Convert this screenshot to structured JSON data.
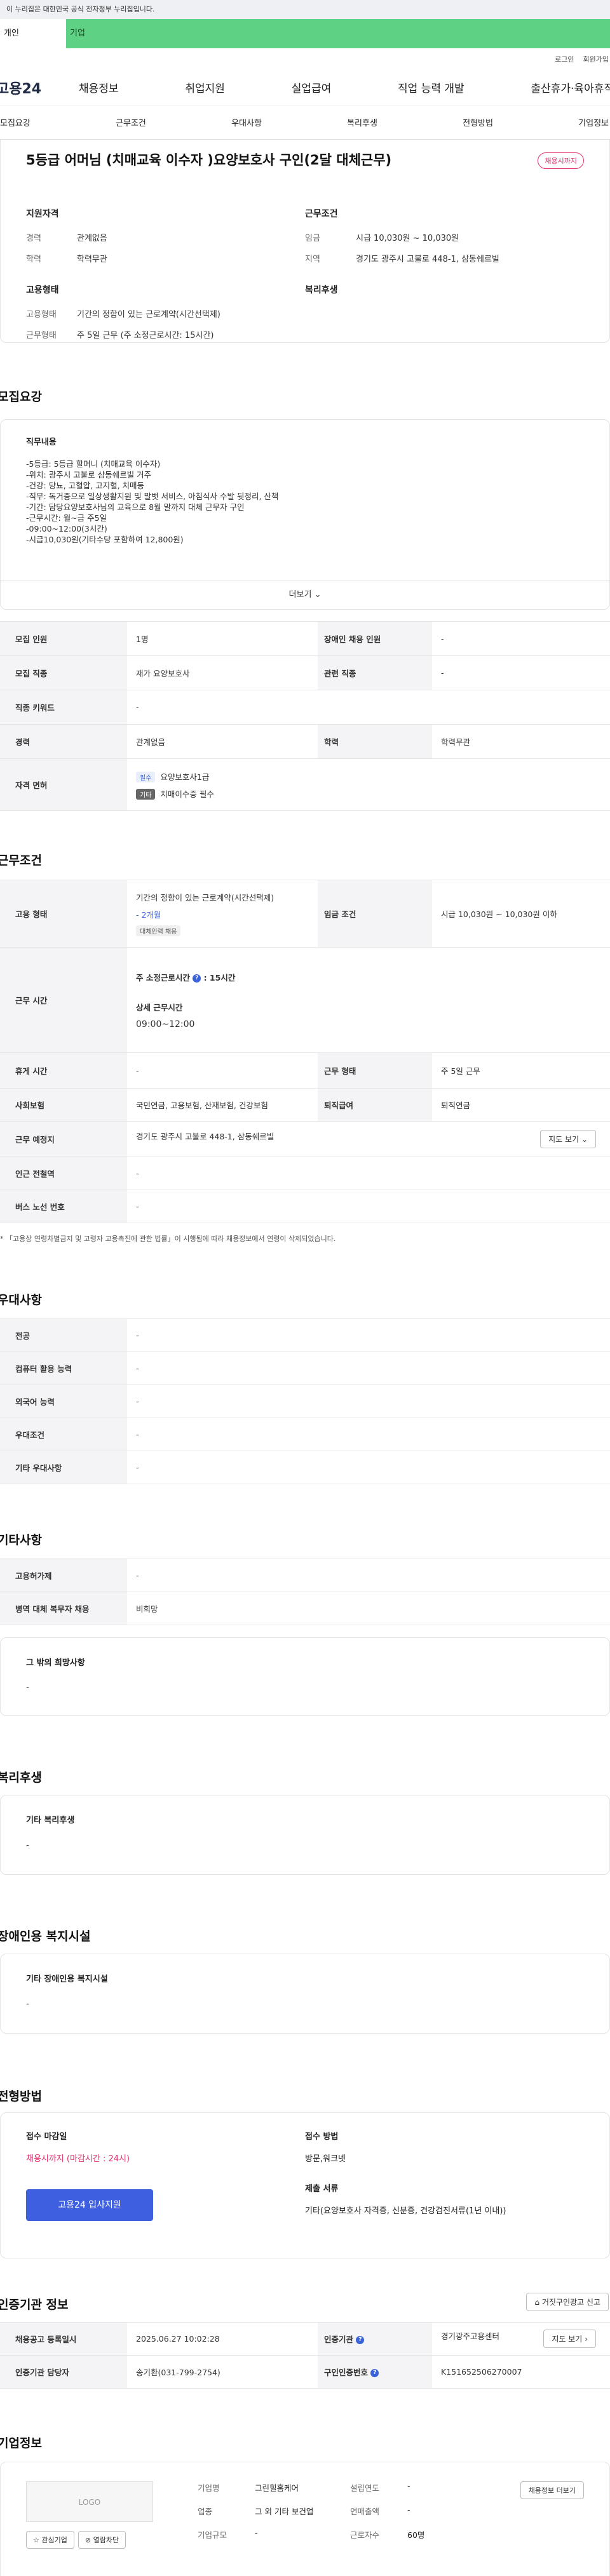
{
  "gov_banner": "이 누리집은 대한민국 공식 전자정부 누리집입니다.",
  "user_types": {
    "personal": "개인",
    "company": "기업"
  },
  "util": {
    "login": "로그인",
    "signup": "회원가입"
  },
  "logo": "고용24",
  "gnb": [
    "채용정보",
    "취업지원",
    "실업급여",
    "직업 능력 개발",
    "출산휴가·육아휴직"
  ],
  "subnav": [
    "모집요강",
    "근무조건",
    "우대사항",
    "복리후생",
    "전형방법",
    "기업정보"
  ],
  "job": {
    "title": "5등급 어머님 (치매교육 이수자 )요양보호사 구인(2달 대체근무)",
    "status_badge": "채용시까지",
    "summary": {
      "qual_heading": "지원자격",
      "career_label": "경력",
      "career": "관계없음",
      "edu_label": "학력",
      "edu": "학력무관",
      "cond_heading": "근무조건",
      "wage_label": "임금",
      "wage": "시급 10,030원 ~ 10,030원",
      "region_label": "지역",
      "region": "경기도 광주시 고불로 448-1, 삼동쉐르빌",
      "emp_heading": "고용형태",
      "emp_type_label": "고용형태",
      "emp_type": "기간의 정함이 있는 근로계약(시간선택제)",
      "work_type_label": "근무형태",
      "work_type": "주 5일 근무 (주 소정근로시간: 15시간)",
      "welfare_heading": "복리후생"
    }
  },
  "recruit": {
    "heading": "모집요강",
    "duty_heading": "직무내용",
    "duty_lines": [
      "-5등급: 5등급 할머니 (치매교육 이수자)",
      "-위치: 광주시 고불로 삼동쉐르빌 거주",
      "-건강: 당뇨, 고혈압, 고지혈, 치매등",
      "-직무: 독거중으로 일상생활지원 및 말벗 서비스, 아침식사 수발 뒷정리, 산책",
      "-기간: 담당요양보호사님의 교육으로 8월 말까지 대체 근무자 구인",
      "-근무시간: 월~금 주5일",
      "-09:00~12:00(3시간)",
      "-시급10,030원(기타수당 포함하여 12,800원)"
    ],
    "more": "더보기",
    "rows": {
      "count_k": "모집 인원",
      "count_v": "1명",
      "disabled_k": "장애인 채용 인원",
      "disabled_v": "-",
      "job_k": "모집 직종",
      "job_v": "재가 요양보호사",
      "related_k": "관련 직종",
      "related_v": "-",
      "keyword_k": "직종 키워드",
      "keyword_v": "-",
      "career_k": "경력",
      "career_v": "관계없음",
      "edu_k": "학력",
      "edu_v": "학력무관",
      "license_k": "자격 면허",
      "license_tag1": "필수",
      "license_v1": "요양보호사1급",
      "license_tag2": "기타",
      "license_v2": "치매이수증 필수"
    }
  },
  "conditions": {
    "heading": "근무조건",
    "emp_k": "고용 형태",
    "emp_v": "기간의 정함이 있는 근로계약(시간선택제)",
    "emp_period": "- 2개월",
    "emp_tag": "대체인력 채용",
    "wage_k": "임금 조건",
    "wage_v": "시급 10,030원 ~ 10,030원 이하",
    "time_k": "근무 시간",
    "time_weekly_label": "주 소정근로시간",
    "time_weekly": ": 15시간",
    "time_detail_label": "상세 근무시간",
    "time_detail": "09:00~12:00",
    "holiday_k": "휴게 시간",
    "holiday_v": "-",
    "worktype_k": "근무 형태",
    "worktype_v": "주 5일 근무",
    "insurance_k": "사회보험",
    "insurance_v": "국민연금, 고용보험, 산재보험, 건강보험",
    "retire_k": "퇴직급여",
    "retire_v": "퇴직연금",
    "place_k": "근무 예정지",
    "place_v": "경기도 광주시 고불로 448-1, 삼동쉐르빌",
    "map_btn": "지도 보기",
    "subway_k": "인근 전철역",
    "subway_v": "-",
    "bus_k": "버스 노선 번호",
    "bus_v": "-",
    "note": "* 「고용상 연령차별금지 및 고령자 고용촉진에 관한 법률」이 시행됨에 따라 채용정보에서 연령이 삭제되었습니다."
  },
  "preference": {
    "heading": "우대사항",
    "major_k": "전공",
    "major_v": "-",
    "computer_k": "컴퓨터 활용 능력",
    "computer_v": "-",
    "lang_k": "외국어 능력",
    "lang_v": "-",
    "cond_k": "우대조건",
    "cond_v": "-",
    "etc_k": "기타 우대사항",
    "etc_v": "-"
  },
  "other": {
    "heading": "기타사항",
    "hire_k": "고용허가제",
    "hire_v": "-",
    "military_k": "병역 대체 복무자 채용",
    "military_v": "비희망",
    "wish_h": "그 밖의 희망사항",
    "wish_v": "-"
  },
  "welfare": {
    "heading": "복리후생",
    "h": "기타 복리후생",
    "v": "-"
  },
  "disability": {
    "heading": "장애인용 복지시설",
    "h": "기타 장애인용 복지시설",
    "v": "-"
  },
  "selection": {
    "heading": "전형방법",
    "deadline_h": "접수 마감일",
    "deadline_v": "채용시까지 (마감시간 : 24시)",
    "apply_btn": "고용24 입사지원",
    "method_h": "접수 방법",
    "method_v": "방문,워크넷",
    "docs_h": "제출 서류",
    "docs_v": "기타(요양보호사 자격증, 신분증, 건강검진서류(1년 이내))"
  },
  "cert": {
    "heading": "인증기관 정보",
    "report_btn": "거짓구인광고 신고",
    "reg_k": "채용공고 등록일시",
    "reg_v": "2025.06.27 10:02:28",
    "org_k": "인증기관",
    "org_v": "경기광주고용센터",
    "mgr_k": "인증기관 담당자",
    "mgr_v": "송기환(031-799-2754)",
    "authno_k": "구인인증번호",
    "authno_v": "K151652506270007",
    "map_btn": "지도 보기"
  },
  "company": {
    "heading": "기업정보",
    "logo_text": "LOGO",
    "interest_btn": "관심기업",
    "block_btn": "열람차단",
    "name_k": "기업명",
    "name_v": "그린힐홈케어",
    "year_k": "설립연도",
    "year_v": "-",
    "industry_k": "업종",
    "industry_v": "그 외 기타 보건업",
    "sales_k": "연매출액",
    "sales_v": "-",
    "size_k": "기업규모",
    "size_v": "-",
    "staff_k": "근로자수",
    "staff_v": "60명",
    "other_jobs_btn": "채용정보 더보기"
  }
}
